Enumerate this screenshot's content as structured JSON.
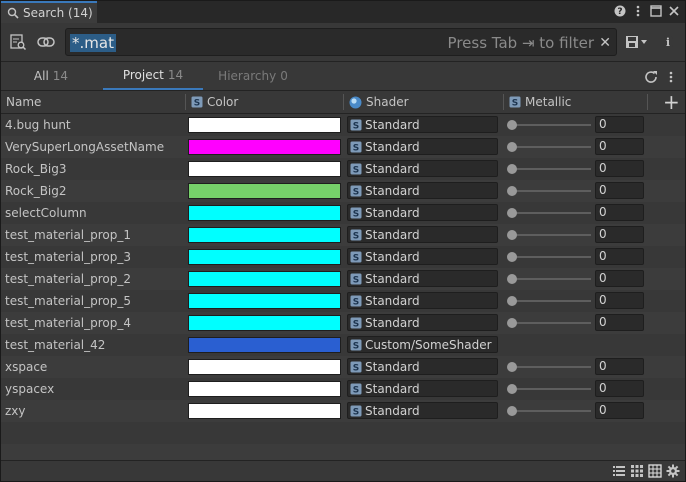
{
  "window": {
    "tab_title": "Search (14)",
    "title_buttons": [
      "help-icon",
      "menu-icon",
      "maximize-icon",
      "close-icon"
    ]
  },
  "toolbar": {
    "query": "*.mat",
    "hint": "Press Tab ⇥ to filter",
    "clear": "✕",
    "left_icons": [
      "saved-searches-icon",
      "sync-icon"
    ],
    "right_icons": [
      "save-query-icon",
      "info-icon"
    ]
  },
  "provider_tabs": [
    {
      "label": "All",
      "count": "14"
    },
    {
      "label": "Project",
      "count": "14"
    },
    {
      "label": "Hierarchy",
      "count": "0"
    }
  ],
  "columns": {
    "name": "Name",
    "color": "Color",
    "shader": "Shader",
    "metallic": "Metallic",
    "add": "+"
  },
  "rows": [
    {
      "name": "4.bug hunt",
      "color": "#ffffff",
      "shader": "Standard",
      "metallic": "0"
    },
    {
      "name": "VerySuperLongAssetName",
      "color": "#ff00ff",
      "shader": "Standard",
      "metallic": "0"
    },
    {
      "name": "Rock_Big3",
      "color": "#ffffff",
      "shader": "Standard",
      "metallic": "0"
    },
    {
      "name": "Rock_Big2",
      "color": "#76d16a",
      "shader": "Standard",
      "metallic": "0"
    },
    {
      "name": "selectColumn",
      "color": "#00ffff",
      "shader": "Standard",
      "metallic": "0"
    },
    {
      "name": "test_material_prop_1",
      "color": "#00ffff",
      "shader": "Standard",
      "metallic": "0"
    },
    {
      "name": "test_material_prop_3",
      "color": "#00ffff",
      "shader": "Standard",
      "metallic": "0"
    },
    {
      "name": "test_material_prop_2",
      "color": "#00ffff",
      "shader": "Standard",
      "metallic": "0"
    },
    {
      "name": "test_material_prop_5",
      "color": "#00ffff",
      "shader": "Standard",
      "metallic": "0"
    },
    {
      "name": "test_material_prop_4",
      "color": "#00ffff",
      "shader": "Standard",
      "metallic": "0"
    },
    {
      "name": "test_material_42",
      "color": "#2a5fd1",
      "shader": "Custom/SomeShader",
      "metallic": null
    },
    {
      "name": "xspace",
      "color": "#ffffff",
      "shader": "Standard",
      "metallic": "0"
    },
    {
      "name": "yspacex",
      "color": "#ffffff",
      "shader": "Standard",
      "metallic": "0"
    },
    {
      "name": "zxy",
      "color": "#ffffff",
      "shader": "Standard",
      "metallic": "0"
    }
  ],
  "status_icons": [
    "list-view-icon",
    "grid-small-icon",
    "table-view-icon",
    "settings-icon"
  ],
  "colors": {
    "accent": "#3a79bb",
    "selection": "#2c5d87"
  }
}
